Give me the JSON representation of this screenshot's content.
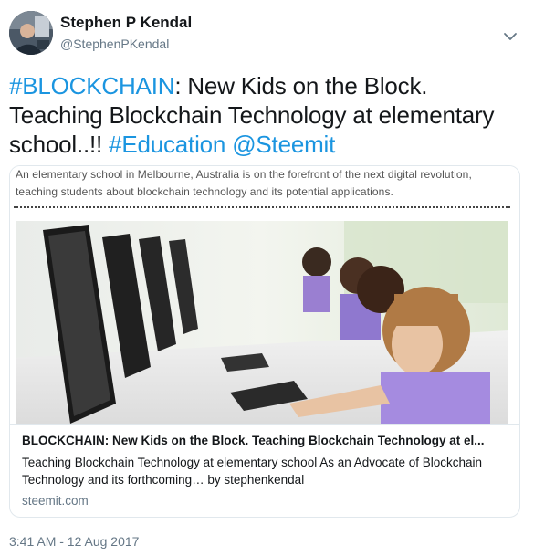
{
  "author": {
    "name": "Stephen P Kendal",
    "handle": "@StephenPKendal"
  },
  "tweet": {
    "hashtag_blockchain": "#BLOCKCHAIN",
    "text_main": ": New Kids on the Block. Teaching Blockchain Technology at elementary school..!! ",
    "hashtag_education": "#Education",
    "mention": "@Steemit"
  },
  "card": {
    "snippet": "An elementary school in Melbourne, Australia is on the forefront of the next digital revolution, teaching students about blockchain technology and its potential applications.",
    "title": "BLOCKCHAIN: New Kids on the Block. Teaching Blockchain Technology at el...",
    "description": "Teaching Blockchain Technology at elementary school As an Advocate of Blockchain Technology and its forthcoming… by stephenkendal",
    "domain": "steemit.com"
  },
  "timestamp": "3:41 AM - 12 Aug 2017",
  "colors": {
    "link": "#1b95e0",
    "muted": "#657786",
    "border": "#e1e8ed"
  },
  "icons": {
    "menu": "chevron-down-icon"
  }
}
